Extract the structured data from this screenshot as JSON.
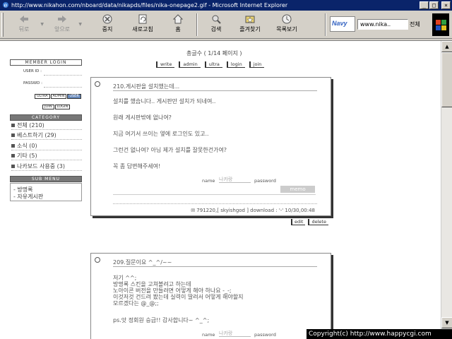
{
  "window": {
    "title": "http://www.nikahon.com/nboard/data/nikapds/files/nika-onepage2.gif - Microsoft Internet Explorer",
    "controls": [
      "_",
      "□",
      "×"
    ]
  },
  "toolbar": {
    "back_label": "뒤로",
    "forward_label": "앞으로",
    "stop_label": "중지",
    "refresh_label": "새로고침",
    "home_label": "홈",
    "search_label": "검색",
    "favorites_label": "즐겨찾기",
    "history_label": "목록보기",
    "brand_text": "Navy",
    "address_value": "www.nika..",
    "address_option": "전체"
  },
  "sidebar": {
    "member_login_heading": "MEMBER LOGIN",
    "userid_label": "USER ID :",
    "password_label": "PASSWD :",
    "mini_buttons": [
      "ULTRA",
      "ADMIN",
      "USER"
    ],
    "join_login": [
      "JOIN",
      "LOGIN"
    ],
    "category_heading": "CATEGORY",
    "categories": [
      {
        "label": "전체 (210)"
      },
      {
        "label": "베스트하기 (29)"
      },
      {
        "label": "소식 (0)"
      },
      {
        "label": "기타 (5)"
      },
      {
        "label": "나카보드 사용중 (3)"
      }
    ],
    "sub_menu_heading": "SUB MENU",
    "sub_items": [
      "- 방명록",
      "- 자유게시판"
    ]
  },
  "main": {
    "total_count": "총글수 ( 1/14 페이지 )",
    "top_buttons": [
      "write",
      "admin",
      "ultra",
      "login",
      "join"
    ],
    "posts": [
      {
        "title": "210.게시판을 설치했는데...",
        "lines": [
          "설치를 했습니다.. 게시판만 설치가 되네여..",
          "원래 게시판밖에 없나여?",
          "지금 여기서 쓰이는 옆에 로그인도 있고..",
          "그런건 없나여? 아님 제가 설치를 잘못한건가여?",
          "꼭 좀 답변해주세여!"
        ],
        "name_label": "name",
        "name_placeholder": "나카랑",
        "password_label": "password",
        "memo_button": "memo",
        "footer": "✉ 791220,[ skyishgod ] download : '-' 10/30,00:48"
      },
      {
        "title": "209.질문이요 ^_^/~~",
        "lines": [
          "저기 ^^;",
          "방명록 스킨을 고쳐볼려고 하는데",
          "노아이콘 버전을 만들려면 어떻게 해야 하나요 -_-;",
          "이것저것 건드려 봤는데 실력이 딸려서 어떻게 해야할지",
          "모르겠다는 @_@;;",
          "",
          "ps.앗 정회원 승급!! 감사합니다~ ^_^;"
        ],
        "name_label": "name",
        "name_placeholder": "나카랑",
        "password_label": "password"
      }
    ],
    "edit_label": "edit",
    "delete_label": "delete"
  },
  "copyright": "Copyright(c) http://www.happycgi.com"
}
